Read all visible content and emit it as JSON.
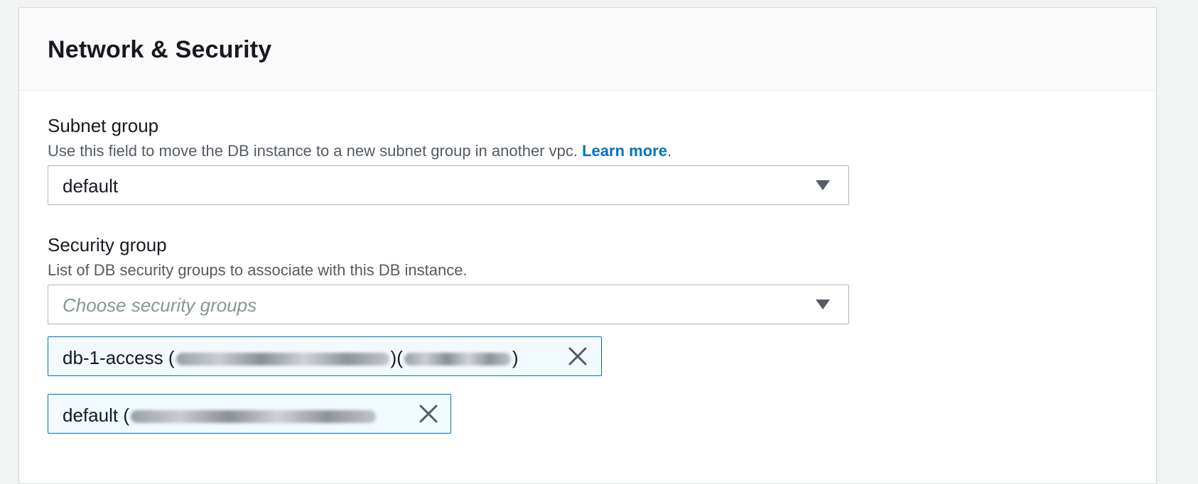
{
  "panel": {
    "title": "Network & Security"
  },
  "subnet_group": {
    "label": "Subnet group",
    "description": "Use this field to move the DB instance to a new subnet group in another vpc.",
    "learn_more": "Learn more",
    "description_end": ".",
    "selected_value": "default",
    "caret_icon": "caret-down-icon"
  },
  "security_group": {
    "label": "Security group",
    "description": "List of DB security groups to associate with this DB instance.",
    "placeholder": "Choose security groups",
    "caret_icon": "caret-down-icon",
    "tokens": [
      {
        "name": "db-1-access",
        "remove_icon": "close-icon"
      },
      {
        "name": "default",
        "remove_icon": "close-icon"
      }
    ]
  },
  "colors": {
    "link": "#0073bb",
    "token_border": "#0073bb",
    "token_bg": "#f1faff",
    "header_bg": "#fafafa"
  }
}
